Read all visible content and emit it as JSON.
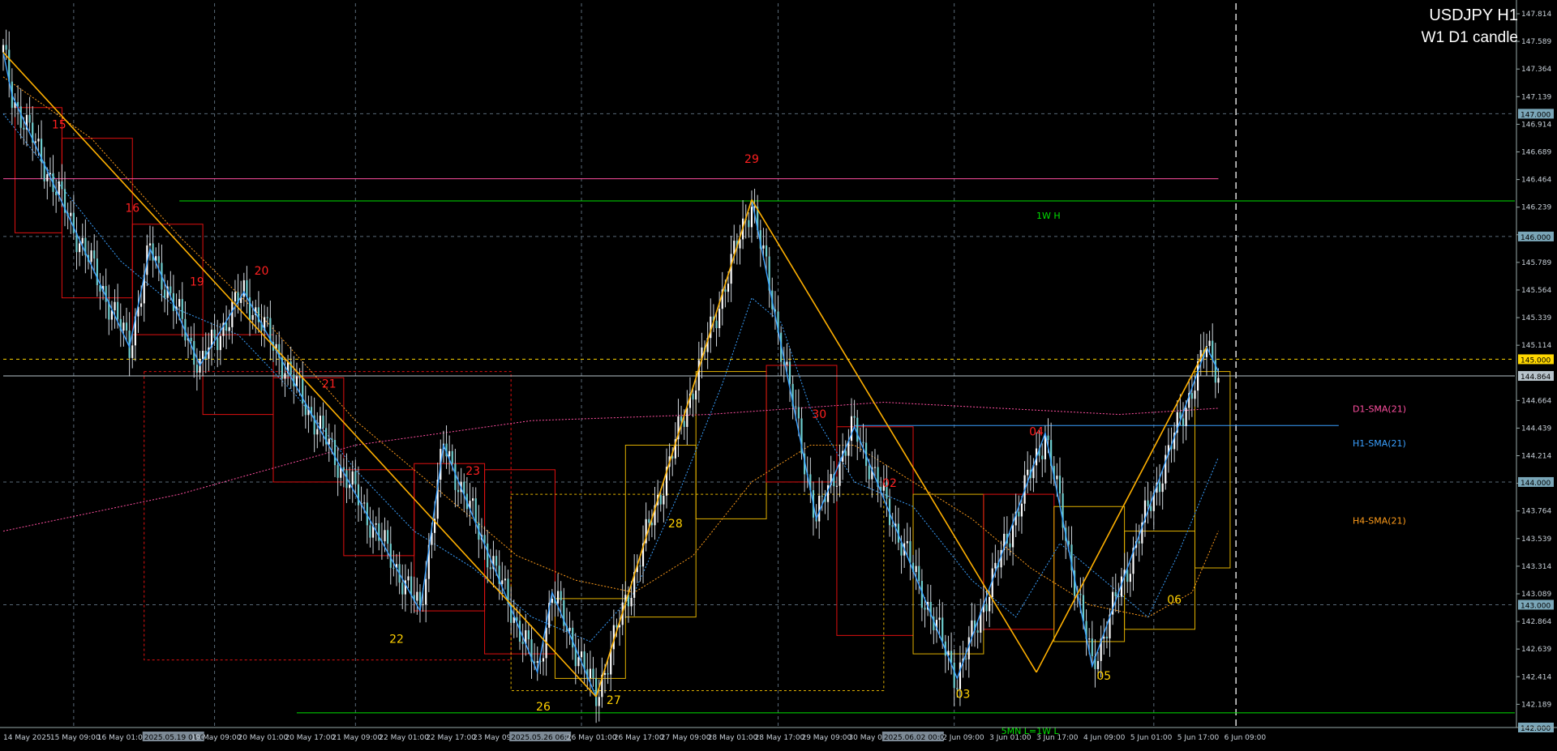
{
  "chart_data": {
    "type": "candlestick",
    "symbol_title": "USDJPY H1",
    "subtitle": "W1 D1 candle",
    "ylim": [
      142.0,
      147.9
    ],
    "x_range_hours": [
      0,
      515
    ],
    "y_tick_labels": [
      "147.814",
      "147.589",
      "147.364",
      "147.139",
      "146.914",
      "146.689",
      "146.464",
      "146.239",
      "146.014",
      "145.789",
      "145.564",
      "145.339",
      "145.114",
      "144.664",
      "144.439",
      "144.214",
      "143.989",
      "143.764",
      "143.539",
      "143.314",
      "143.089",
      "142.864",
      "142.639",
      "142.414",
      "142.189"
    ],
    "y_ticks": [
      147.814,
      147.589,
      147.364,
      147.139,
      146.914,
      146.689,
      146.464,
      146.239,
      146.014,
      145.789,
      145.564,
      145.339,
      145.114,
      144.664,
      144.439,
      144.214,
      143.989,
      143.764,
      143.539,
      143.314,
      143.089,
      142.864,
      142.639,
      142.414,
      142.189
    ],
    "price_tags": [
      {
        "label": "147.000",
        "value": 147.0,
        "color": "#7aa6b8"
      },
      {
        "label": "146.000",
        "value": 146.0,
        "color": "#7aa6b8"
      },
      {
        "label": "145.000",
        "value": 145.0,
        "color": "#ffd700"
      },
      {
        "label": "144.864",
        "value": 144.864,
        "color": "#b8c4cc"
      },
      {
        "label": "144.000",
        "value": 144.0,
        "color": "#7aa6b8"
      },
      {
        "label": "143.000",
        "value": 143.0,
        "color": "#7aa6b8"
      },
      {
        "label": "142.000",
        "value": 142.0,
        "color": "#7aa6b8"
      }
    ],
    "x_tick_labels": [
      {
        "h": 0,
        "label": "14 May 2025"
      },
      {
        "h": 16,
        "label": "15 May 09:00"
      },
      {
        "h": 32,
        "label": "16 May 01:00"
      },
      {
        "h": 48,
        "label": "2025.05.19 01:00",
        "boxed": true
      },
      {
        "h": 64,
        "label": "19 May 09:00"
      },
      {
        "h": 80,
        "label": "20 May 01:00"
      },
      {
        "h": 96,
        "label": "20 May 17:00"
      },
      {
        "h": 112,
        "label": "21 May 09:00"
      },
      {
        "h": 128,
        "label": "22 May 01:00"
      },
      {
        "h": 144,
        "label": "22 May 17:00"
      },
      {
        "h": 160,
        "label": "23 May 09:00"
      },
      {
        "h": 173,
        "label": "2025.05.26 06:00",
        "boxed": true
      },
      {
        "h": 192,
        "label": "26 May 01:00"
      },
      {
        "h": 208,
        "label": "26 May 17:00"
      },
      {
        "h": 224,
        "label": "27 May 09:00"
      },
      {
        "h": 240,
        "label": "28 May 01:00"
      },
      {
        "h": 256,
        "label": "28 May 17:00"
      },
      {
        "h": 272,
        "label": "29 May 09:00"
      },
      {
        "h": 288,
        "label": "30 May 01:00"
      },
      {
        "h": 300,
        "label": "2025.06.02 00:00",
        "boxed": true
      },
      {
        "h": 320,
        "label": "2 Jun 09:00"
      },
      {
        "h": 336,
        "label": "3 Jun 01:00"
      },
      {
        "h": 352,
        "label": "3 Jun 17:00"
      },
      {
        "h": 368,
        "label": "4 Jun 09:00"
      },
      {
        "h": 384,
        "label": "5 Jun 01:00"
      },
      {
        "h": 400,
        "label": "5 Jun 17:00"
      },
      {
        "h": 416,
        "label": "6 Jun 09:00"
      }
    ],
    "pivot_points": [
      [
        0,
        147.5
      ],
      [
        3,
        147.15
      ],
      [
        43,
        145.1
      ],
      [
        50,
        145.9
      ],
      [
        67,
        144.95
      ],
      [
        82,
        145.55
      ],
      [
        142,
        142.95
      ],
      [
        150,
        144.3
      ],
      [
        182,
        142.45
      ],
      [
        187,
        143.1
      ],
      [
        202,
        142.25
      ],
      [
        255,
        146.3
      ],
      [
        277,
        143.7
      ],
      [
        290,
        144.45
      ],
      [
        325,
        142.4
      ],
      [
        355,
        144.4
      ],
      [
        371,
        142.5
      ],
      [
        410,
        145.1
      ],
      [
        414,
        144.9
      ]
    ],
    "trend_lines": [
      {
        "name": "hline-resistance",
        "h1": 0,
        "p1": 147.5,
        "h2": 202,
        "p2": 142.25
      },
      {
        "name": "leg-up",
        "h1": 202,
        "p1": 142.25,
        "h2": 255,
        "p2": 146.3
      },
      {
        "name": "leg-down",
        "h1": 255,
        "p1": 146.3,
        "h2": 352,
        "p2": 142.45
      },
      {
        "name": "leg-up-2",
        "h1": 352,
        "p1": 142.45,
        "h2": 410,
        "p2": 145.1
      }
    ],
    "sma_h1_path": [
      [
        0,
        147.0
      ],
      [
        20,
        146.4
      ],
      [
        40,
        145.8
      ],
      [
        60,
        145.4
      ],
      [
        80,
        145.2
      ],
      [
        100,
        144.7
      ],
      [
        120,
        144.1
      ],
      [
        140,
        143.6
      ],
      [
        160,
        143.3
      ],
      [
        180,
        142.9
      ],
      [
        200,
        142.7
      ],
      [
        215,
        143.1
      ],
      [
        230,
        143.9
      ],
      [
        245,
        144.8
      ],
      [
        255,
        145.5
      ],
      [
        265,
        145.3
      ],
      [
        275,
        144.6
      ],
      [
        290,
        144.0
      ],
      [
        310,
        143.8
      ],
      [
        330,
        143.2
      ],
      [
        345,
        142.9
      ],
      [
        360,
        143.5
      ],
      [
        375,
        143.2
      ],
      [
        390,
        142.9
      ],
      [
        400,
        143.4
      ],
      [
        414,
        144.2
      ]
    ],
    "sma_h4_path": [
      [
        0,
        147.3
      ],
      [
        30,
        146.8
      ],
      [
        60,
        146.0
      ],
      [
        90,
        145.3
      ],
      [
        120,
        144.5
      ],
      [
        150,
        143.9
      ],
      [
        175,
        143.4
      ],
      [
        195,
        143.2
      ],
      [
        215,
        143.1
      ],
      [
        235,
        143.4
      ],
      [
        255,
        144.0
      ],
      [
        275,
        144.3
      ],
      [
        290,
        144.3
      ],
      [
        310,
        144.0
      ],
      [
        330,
        143.7
      ],
      [
        350,
        143.3
      ],
      [
        370,
        143.0
      ],
      [
        390,
        142.9
      ],
      [
        405,
        143.1
      ],
      [
        414,
        143.6
      ]
    ],
    "sma_d1_path": [
      [
        0,
        143.6
      ],
      [
        60,
        143.9
      ],
      [
        120,
        144.3
      ],
      [
        180,
        144.5
      ],
      [
        240,
        144.55
      ],
      [
        300,
        144.65
      ],
      [
        340,
        144.6
      ],
      [
        380,
        144.55
      ],
      [
        414,
        144.6
      ]
    ],
    "hlines": [
      {
        "name": "1w-high-line",
        "value": 146.29,
        "h1": 60,
        "h2": 515,
        "color": "#00e000",
        "label": "1W H",
        "label_h": 352
      },
      {
        "name": "5mn-low-line",
        "value": 142.12,
        "h1": 100,
        "h2": 515,
        "color": "#00e000",
        "label": "5MN L=1W L",
        "label_h": 340
      },
      {
        "name": "29-high-line",
        "value": 146.47,
        "h1": 0,
        "h2": 414,
        "color": "#ff4fa0"
      },
      {
        "name": "h1-sma-level-line",
        "value": 144.46,
        "h1": 290,
        "h2": 455,
        "color": "#3aa0ff"
      },
      {
        "name": "current-price-line",
        "value": 144.864,
        "h1": 0,
        "h2": 515,
        "color": "#b8c4cc"
      }
    ],
    "day_labels": [
      {
        "text": "15",
        "h": 19,
        "p": 146.88,
        "color": "#ff2020"
      },
      {
        "text": "16",
        "h": 44,
        "p": 146.2,
        "color": "#ff2020"
      },
      {
        "text": "19",
        "h": 66,
        "p": 145.6,
        "color": "#ff2020"
      },
      {
        "text": "20",
        "h": 88,
        "p": 145.69,
        "color": "#ff2020"
      },
      {
        "text": "21",
        "h": 111,
        "p": 144.77,
        "color": "#ff2020"
      },
      {
        "text": "22",
        "h": 134,
        "p": 142.69,
        "color": "#ffd000"
      },
      {
        "text": "23",
        "h": 160,
        "p": 144.06,
        "color": "#ff2020"
      },
      {
        "text": "26",
        "h": 184,
        "p": 142.14,
        "color": "#ffd000"
      },
      {
        "text": "27",
        "h": 208,
        "p": 142.19,
        "color": "#ffd000"
      },
      {
        "text": "28",
        "h": 229,
        "p": 143.63,
        "color": "#ffd000"
      },
      {
        "text": "29",
        "h": 255,
        "p": 146.6,
        "color": "#ff2020"
      },
      {
        "text": "30",
        "h": 278,
        "p": 144.52,
        "color": "#ff2020"
      },
      {
        "text": "02",
        "h": 302,
        "p": 143.96,
        "color": "#ff2020"
      },
      {
        "text": "03",
        "h": 327,
        "p": 142.24,
        "color": "#ffd000"
      },
      {
        "text": "04",
        "h": 352,
        "p": 144.38,
        "color": "#ff2020"
      },
      {
        "text": "05",
        "h": 375,
        "p": 142.39,
        "color": "#ffd000"
      },
      {
        "text": "06",
        "h": 399,
        "p": 143.01,
        "color": "#ffd000"
      }
    ],
    "sma_labels": [
      {
        "text": "D1-SMA(21)",
        "p": 144.57,
        "color": "#ff4fa0"
      },
      {
        "text": "H1-SMA(21)",
        "p": 144.29,
        "color": "#3aa0ff"
      },
      {
        "text": "H4-SMA(21)",
        "p": 143.66,
        "color": "#ff9c1a"
      }
    ],
    "colors": {
      "bg": "#000000",
      "grid": "#5a6a78",
      "bull": "#ffffff",
      "bear": "#ffffff",
      "zig": "#3aa0ff",
      "trend": "#ffb000",
      "box_red": "#e01010",
      "box_yellow": "#e0b000"
    }
  }
}
